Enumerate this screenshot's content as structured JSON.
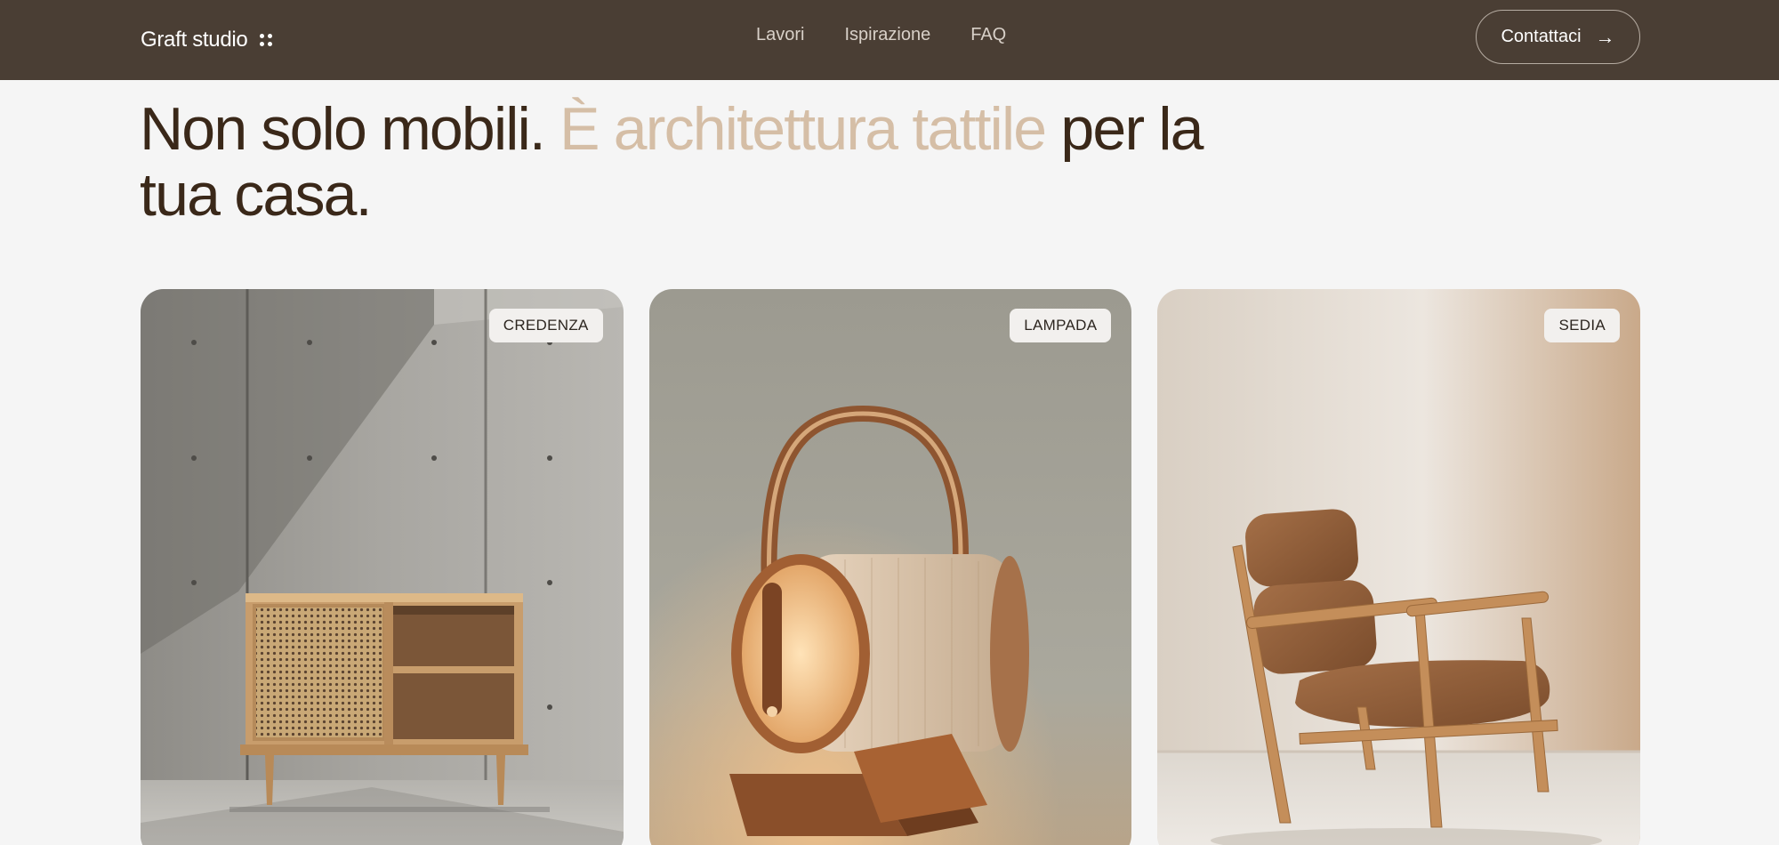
{
  "nav": {
    "logo": "Graft studio",
    "links": [
      "Lavori",
      "Ispirazione",
      "FAQ"
    ],
    "contact_label": "Contattaci",
    "contact_arrow": "→"
  },
  "hero": {
    "title_part1": "Non solo mobili. ",
    "title_accent": "È architettura tattile",
    "title_part2": " per la tua casa."
  },
  "cards": [
    {
      "badge": "CREDENZA",
      "icon": "sideboard-image"
    },
    {
      "badge": "LAMPADA",
      "icon": "lamp-image"
    },
    {
      "badge": "SEDIA",
      "icon": "chair-image"
    }
  ],
  "colors": {
    "nav_bg": "#4a3e34",
    "page_bg": "#f5f5f5",
    "title": "#3a2819",
    "accent": "#d5bea6"
  }
}
